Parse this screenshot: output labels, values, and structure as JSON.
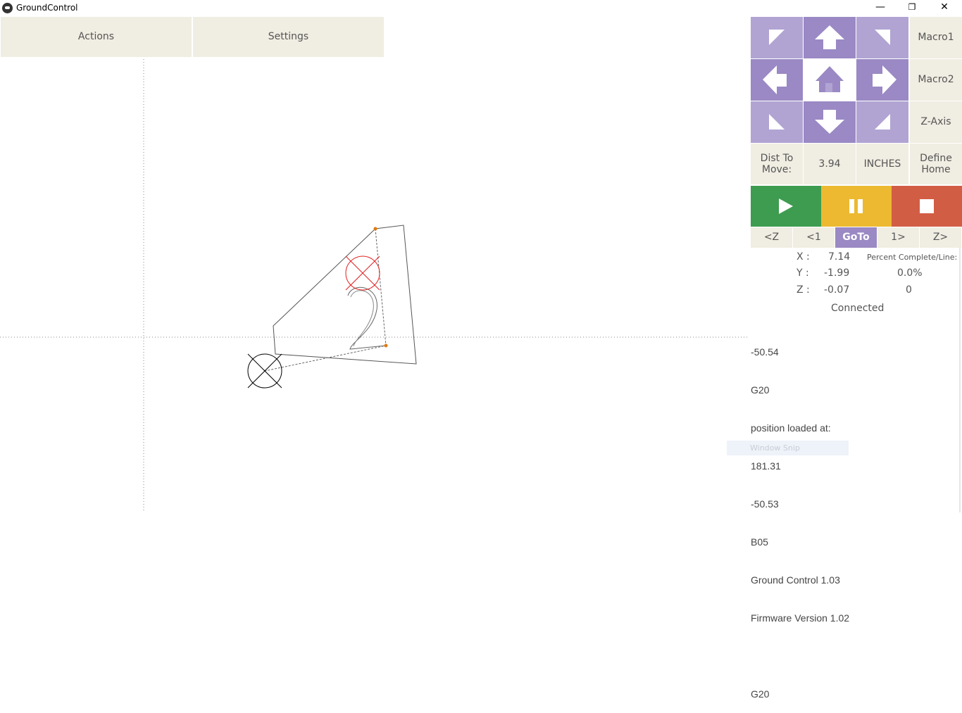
{
  "window": {
    "title": "GroundControl",
    "minimize_glyph": "—",
    "restore_glyph": "❐",
    "close_glyph": "✕"
  },
  "menu": {
    "actions_label": "Actions",
    "settings_label": "Settings"
  },
  "canvas": {
    "part_label": "2",
    "colors": {
      "target_marker": "#e02020",
      "current_marker": "#000000",
      "path_point": "#e07a10",
      "cut_lines": "#555555",
      "grid": "#888888"
    }
  },
  "jog_pad": {
    "icons": [
      "arrow-up-left-icon",
      "arrow-up-icon",
      "arrow-up-right-icon",
      "arrow-left-icon",
      "home-icon",
      "arrow-right-icon",
      "arrow-down-left-icon",
      "arrow-down-icon",
      "arrow-down-right-icon"
    ],
    "colors": {
      "light": "#b1a4d3",
      "dark": "#9a89c4"
    }
  },
  "side": {
    "macro1": "Macro1",
    "macro2": "Macro2",
    "z_axis": "Z-Axis"
  },
  "move": {
    "dist_label": "Dist To Move:",
    "dist_value": "3.94",
    "units": "INCHES",
    "define_home": "Define Home"
  },
  "controls": {
    "play_icon": "play-icon",
    "pause_icon": "pause-icon",
    "stop_icon": "stop-icon",
    "colors": {
      "play": "#3d9c4f",
      "pause": "#ecb931",
      "stop": "#d25d45"
    }
  },
  "step": {
    "z_back": "<Z",
    "back_1": "<1",
    "goto": "GoTo",
    "fwd_1": "1>",
    "z_fwd": "Z>"
  },
  "position": {
    "x_label": "X :",
    "x_value": "7.14",
    "y_label": "Y :",
    "y_value": "-1.99",
    "z_label": "Z :",
    "z_value": "-0.07",
    "percent_label": "Percent Complete/Line:",
    "percent_value": "0.0%",
    "line_value": "0",
    "status": "Connected"
  },
  "console": {
    "lines": [
      "-50.54",
      "G20",
      "position loaded at:",
      "181.31",
      "-50.53",
      "B05",
      "Ground Control 1.03",
      "Firmware Version 1.02",
      "",
      "G20"
    ]
  },
  "overlay": {
    "snip_label": "Window Snip"
  }
}
